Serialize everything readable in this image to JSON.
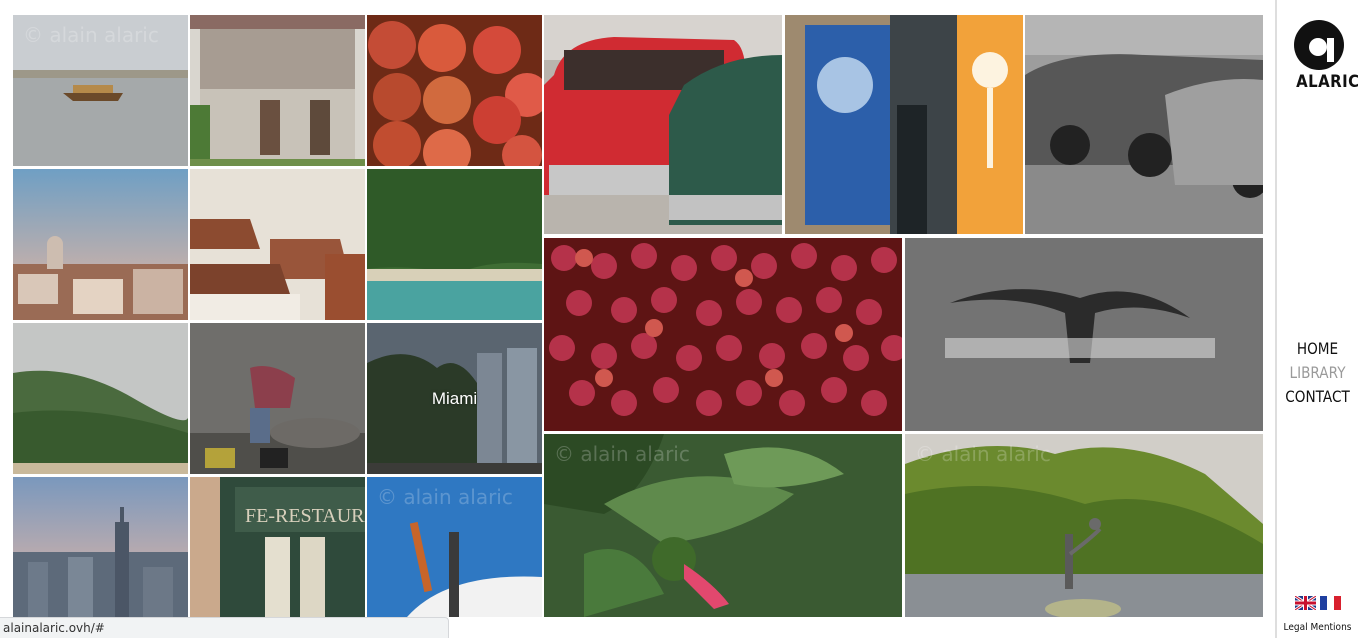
{
  "site": {
    "logo_text": "ALARIC",
    "accent": "#111111"
  },
  "nav": {
    "home": "HOME",
    "library": "LIBRARY",
    "contact": "CONTACT"
  },
  "footer": {
    "legal": "Legal Mentions",
    "languages": [
      "english-flag-icon",
      "french-flag-icon"
    ]
  },
  "gallery": {
    "watermark": "© alain alaric",
    "caption_miami": "Miami"
  },
  "status": {
    "url": "alainalaric.ovh/#"
  }
}
